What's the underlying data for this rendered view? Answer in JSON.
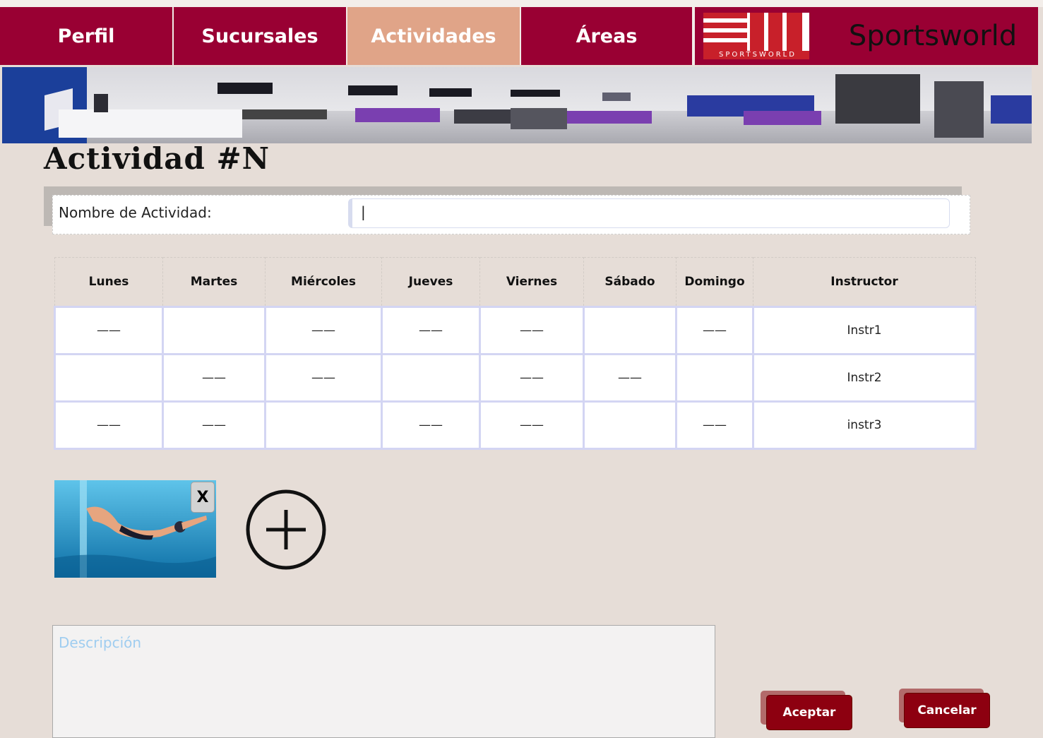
{
  "nav": {
    "tabs": [
      {
        "label": "Perfil"
      },
      {
        "label": "Sucursales"
      },
      {
        "label": "Actividades"
      },
      {
        "label": "Áreas"
      }
    ],
    "logo_text": "SPORTSWORLD",
    "brand": "Sportsworld"
  },
  "page": {
    "title": "Actividad #N",
    "name_label": "Nombre de Actividad:",
    "name_value": "|"
  },
  "schedule": {
    "headers": [
      "Lunes",
      "Martes",
      "Miércoles",
      "Jueves",
      "Viernes",
      "Sábado",
      "Domingo",
      "Instructor"
    ],
    "rows": [
      [
        "——",
        "",
        "——",
        "——",
        "——",
        "",
        "——",
        "Instr1"
      ],
      [
        "",
        "——",
        "——",
        "",
        "——",
        "——",
        "",
        "Instr2"
      ],
      [
        "——",
        "——",
        "",
        "——",
        "——",
        "",
        "——",
        "instr3"
      ]
    ]
  },
  "media": {
    "close_label": "X",
    "add_icon": "plus-circle-icon"
  },
  "description": {
    "placeholder": "Descripción"
  },
  "actions": {
    "accept": "Aceptar",
    "cancel": "Cancelar"
  },
  "colors": {
    "brand": "#990033",
    "active_tab": "#e0a488",
    "background": "#e6ddd7",
    "button": "#8d0010"
  }
}
